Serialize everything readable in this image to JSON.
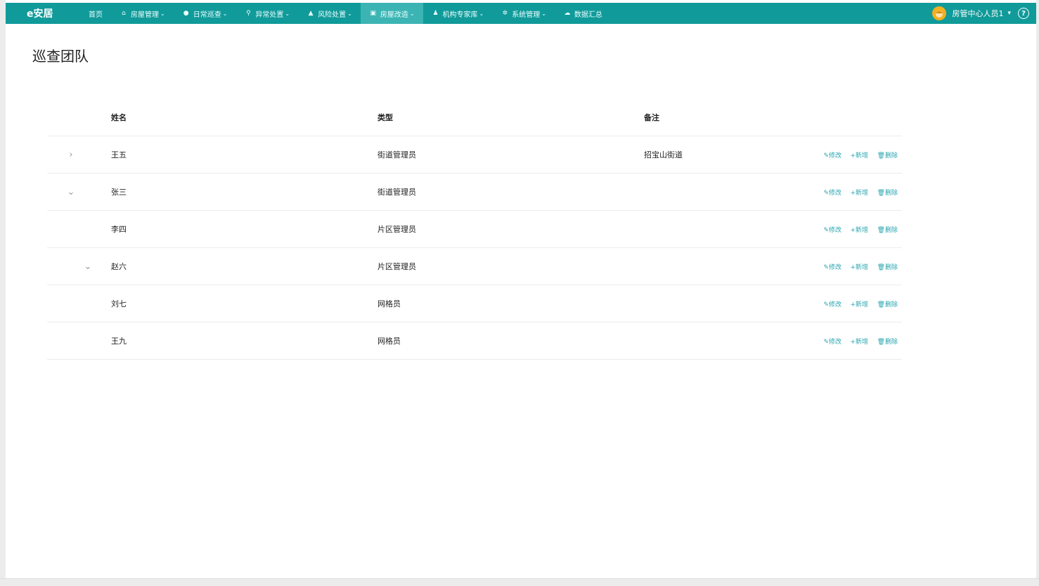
{
  "nav": {
    "brand": "e安居",
    "items": [
      {
        "icon": "",
        "label": "首页",
        "chevron": ""
      },
      {
        "icon": "⌂",
        "label": "房屋管理",
        "chevron": "⌄"
      },
      {
        "icon": "●",
        "label": "日常巡查",
        "chevron": "⌄"
      },
      {
        "icon": "⚲",
        "label": "异常处置",
        "chevron": "⌄"
      },
      {
        "icon": "▲",
        "label": "风险处置",
        "chevron": "⌄"
      },
      {
        "icon": "▣",
        "label": "房屋改造",
        "chevron": "⌄"
      },
      {
        "icon": "♟",
        "label": "机构专家库",
        "chevron": "⌄"
      },
      {
        "icon": "✲",
        "label": "系统管理",
        "chevron": "⌄"
      },
      {
        "icon": "☁",
        "label": "数据汇总",
        "chevron": ""
      }
    ],
    "user": "房管中心人员1",
    "caret": "▾",
    "help": "?"
  },
  "page": {
    "title": "巡查团队"
  },
  "table": {
    "headers": {
      "name": "姓名",
      "type": "类型",
      "note": "备注"
    },
    "rows": [
      {
        "toggle": "›",
        "name": "王五",
        "type": "街道管理员",
        "note": "招宝山街道"
      },
      {
        "toggle": "⌄",
        "name": "张三",
        "type": "街道管理员",
        "note": ""
      },
      {
        "toggle": "",
        "name": "李四",
        "type": "片区管理员",
        "note": ""
      },
      {
        "toggle": "⌄",
        "name": "赵六",
        "type": "片区管理员",
        "note": ""
      },
      {
        "toggle": "",
        "name": "刘七",
        "type": "网格员",
        "note": ""
      },
      {
        "toggle": "",
        "name": "王九",
        "type": "网格员",
        "note": ""
      }
    ],
    "actions": {
      "edit": "✎修改",
      "add": "+新增",
      "delete": "🗑删除"
    }
  },
  "colors": {
    "nav_bg": "#119a9a",
    "nav_active": "#3cb4b4",
    "action": "#2aa6b0"
  }
}
